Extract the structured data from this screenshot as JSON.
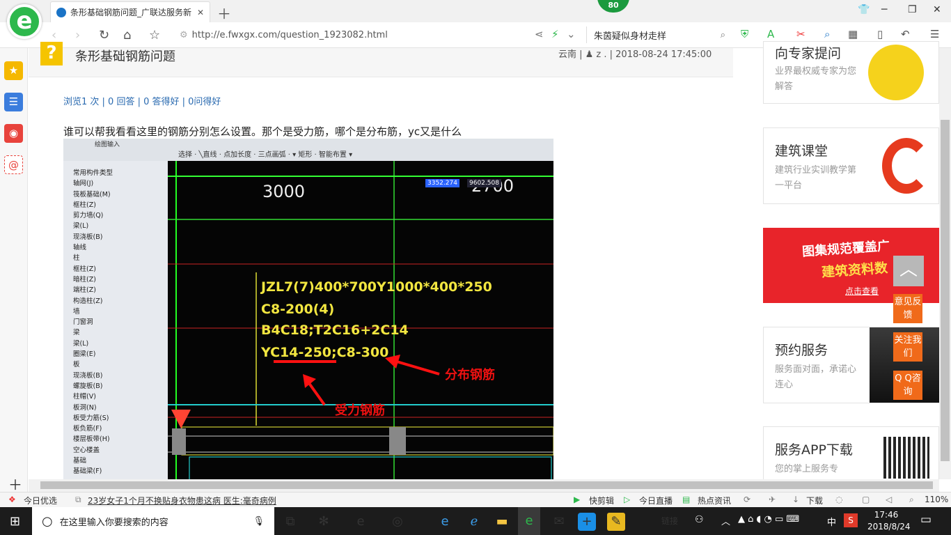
{
  "browser": {
    "tab_title": "条形基础钢筋问题_广联达服务新",
    "badge": "80",
    "url": "http://e.fwxgx.com/question_1923082.html",
    "search_text": "朱茵疑似身材走样"
  },
  "question": {
    "title": "条形基础钢筋问题",
    "meta": "云南 | ♟ z . | 2018-08-24 17:45:00",
    "stats": "浏览1 次 | 0 回答 | 0 答得好 | 0问得好",
    "text": "谁可以帮我看看这里的钢筋分别怎么设置。那个是受力筋，哪个是分布筋，yc又是什么"
  },
  "screenshot": {
    "toolbar_left": "绘图输入",
    "toolbar": "选择 · ╲直线 · 点加长度 · 三点画弧 ·        ▾ 矩形 · 智能布置 ▾",
    "tree": [
      "常用构件类型",
      "轴网(J)",
      "筏板基础(M)",
      "框柱(Z)",
      "剪力墙(Q)",
      "梁(L)",
      "现浇板(B)",
      "轴线",
      "柱",
      "框柱(Z)",
      "暗柱(Z)",
      "端柱(Z)",
      "构造柱(Z)",
      "墙",
      "门窗洞",
      "梁",
      "梁(L)",
      "圈梁(E)",
      "板",
      "现浇板(B)",
      "螺旋板(B)",
      "柱帽(V)",
      "板洞(N)",
      "板受力筋(S)",
      "板负筋(F)",
      "楼层板带(H)",
      "空心楼盖",
      "基础",
      "基础梁(F)"
    ],
    "dim1": "3000",
    "dim2": "2700",
    "coord1": "3352.274",
    "coord2": "9602.508",
    "lines": [
      "JZL7(7)400*700Y1000*400*250",
      "C8-200(4)",
      "B4C18;T2C16+2C14",
      "YC14-250;C8-300"
    ],
    "label_distribution": "分布钢筋",
    "label_stress": "受力钢筋"
  },
  "sidebar": {
    "card1_title": "向专家提问",
    "card1_desc": "业界最权威专家为您解答",
    "card2_title": "建筑课堂",
    "card2_desc": "建筑行业实训教学第一平台",
    "ad_line1": "图集规范覆盖广",
    "ad_line2": "建筑资料数",
    "ad_link": "点击查看",
    "card3_title": "预约服务",
    "card3_desc": "服务面对面，承诺心连心",
    "card4_title": "服务APP下载",
    "card4_desc": "您的掌上服务专"
  },
  "float": {
    "feedback": "意见反馈",
    "follow": "关注我们",
    "qq": "Q Q咨询"
  },
  "status": {
    "today": "今日优选",
    "news": "23岁女子1个月不换贴身衣物患这病 医生:毫奇病例",
    "items": [
      "快剪辑",
      "今日直播",
      "热点资讯",
      "下载"
    ],
    "zoom": "110%"
  },
  "taskbar": {
    "search": "在这里输入你要搜索的内容",
    "links": "链接",
    "ime": "中",
    "time": "17:46",
    "date": "2018/8/24"
  }
}
